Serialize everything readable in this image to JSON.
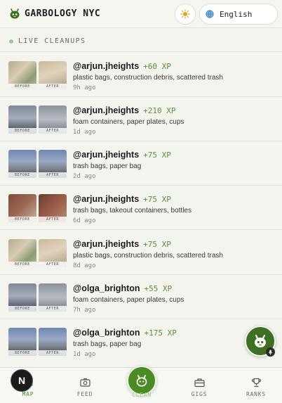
{
  "header": {
    "app_title": "GARBOLOGY NYC",
    "language": "English"
  },
  "feed": {
    "section_label": "LIVE CLEANUPS",
    "before_tag": "BEFORE",
    "after_tag": "AFTER",
    "items": [
      {
        "user": "@arjun.jheights",
        "xp": "+60 XP",
        "items": "plastic bags, construction debris, scattered trash",
        "ago": "9h ago"
      },
      {
        "user": "@arjun.jheights",
        "xp": "+210 XP",
        "items": "foam containers, paper plates, cups",
        "ago": "1d ago"
      },
      {
        "user": "@arjun.jheights",
        "xp": "+75 XP",
        "items": "trash bags, paper bag",
        "ago": "2d ago"
      },
      {
        "user": "@arjun.jheights",
        "xp": "+75 XP",
        "items": "trash bags, takeout containers, bottles",
        "ago": "6d ago"
      },
      {
        "user": "@arjun.jheights",
        "xp": "+75 XP",
        "items": "plastic bags, construction debris, scattered trash",
        "ago": "8d ago"
      },
      {
        "user": "@olga_brighton",
        "xp": "+55 XP",
        "items": "foam containers, paper plates, cups",
        "ago": "7h ago"
      },
      {
        "user": "@olga_brighton",
        "xp": "+175 XP",
        "items": "trash bags, paper bag",
        "ago": "1d ago"
      }
    ]
  },
  "nav": {
    "map": "MAP",
    "feed": "FEED",
    "clean": "CLEAN",
    "gigs": "GIGS",
    "ranks": "RANKS",
    "avatar_letter": "N"
  },
  "colors": {
    "accent": "#4b8a25",
    "xp_green": "#5c8f3c",
    "background": "#f4f4ef"
  },
  "icons": [
    "mascot-logo-icon",
    "sun-icon",
    "globe-icon",
    "camera-icon",
    "briefcase-icon",
    "trophy-icon",
    "mic-icon"
  ]
}
